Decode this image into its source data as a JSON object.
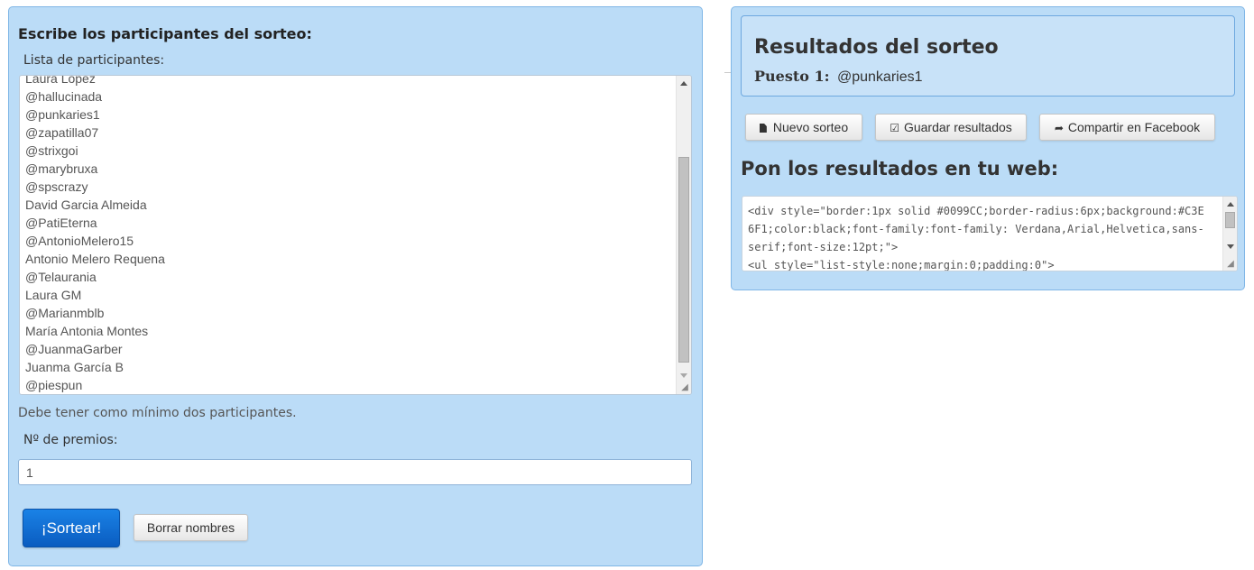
{
  "form": {
    "heading": "Escribe los participantes del sorteo:",
    "list_label": "Lista de participantes:",
    "participants": [
      "Laura López",
      "@hallucinada",
      "@punkaries1",
      "@zapatilla07",
      "@strixgoi",
      "@marybruxa",
      "@spscrazy",
      "David Garcia Almeida",
      "@PatiEterna",
      "@AntonioMelero15",
      "Antonio Melero Requena",
      "@Telaurania",
      "Laura GM",
      "@Marianmblb",
      "María Antonia Montes",
      "@JuanmaGarber",
      "Juanma García B",
      "@piespun"
    ],
    "hint": "Debe tener como mínimo dos participantes.",
    "prizes_label": "Nº de premios:",
    "prizes_value": "1",
    "draw_button": "¡Sortear!",
    "clear_button": "Borrar nombres"
  },
  "results": {
    "title": "Resultados del sorteo",
    "winner_label": "Puesto 1:",
    "winner_value": "@punkaries1",
    "new_button": "Nuevo sorteo",
    "save_button": "Guardar resultados",
    "share_button": "Compartir en Facebook",
    "embed_heading": "Pon los resultados en tu web:",
    "embed_code": "<div style=\"border:1px solid #0099CC;border-radius:6px;background:#C3E6F1;color:black;font-family:font-family: Verdana,Arial,Helvetica,sans-serif;font-size:12pt;\">\n<ul style=\"list-style:none;margin:0;padding:0\">"
  },
  "colors": {
    "panel_bg": "#bbdcf7",
    "panel_border": "#7fb6e6",
    "primary_button": "#0a5cc0"
  },
  "icons": {
    "new": "document-icon",
    "save": "edit-check-icon",
    "share": "share-arrow-icon"
  }
}
